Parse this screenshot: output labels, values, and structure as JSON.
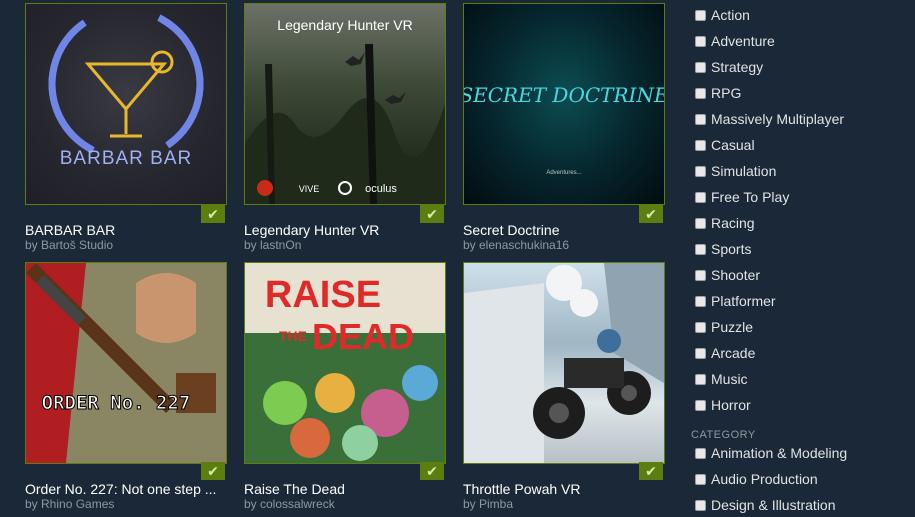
{
  "games": [
    {
      "title": "BARBAR BAR",
      "author": "by Bartoš Studio",
      "art_text": "BARBAR BAR",
      "checked": true
    },
    {
      "title": "Legendary Hunter VR",
      "author": "by lastnOn",
      "art_text": "Legendary Hunter VR",
      "art_logos": [
        "VIVE",
        "oculus"
      ],
      "checked": true
    },
    {
      "title": "Secret Doctrine",
      "author": "by elenaschukina16",
      "art_text": "SECRET DOCTRINE",
      "art_sub": "Adventures...",
      "checked": true
    },
    {
      "title": "Order No. 227: Not one step ...",
      "author": "by Rhino Games",
      "art_text": "ORDER No. 227",
      "checked": true
    },
    {
      "title": "Raise The Dead",
      "author": "by colossalwreck",
      "art_text_1": "RAISE",
      "art_text_2": "THE",
      "art_text_3": "DEAD",
      "checked": true
    },
    {
      "title": "Throttle Powah VR",
      "author": "by Pimba",
      "checked": true
    }
  ],
  "check_glyph": "✔",
  "sidebar": {
    "genre_items": [
      "Action",
      "Adventure",
      "Strategy",
      "RPG",
      "Massively Multiplayer",
      "Casual",
      "Simulation",
      "Free To Play",
      "Racing",
      "Sports",
      "Shooter",
      "Platformer",
      "Puzzle",
      "Arcade",
      "Music",
      "Horror"
    ],
    "category_label": "CATEGORY",
    "category_items": [
      "Animation & Modeling",
      "Audio Production",
      "Design & Illustration"
    ]
  },
  "colors": {
    "background": "#1b2838",
    "check_green": "#5c7e10",
    "muted_text": "#8f98a0"
  }
}
